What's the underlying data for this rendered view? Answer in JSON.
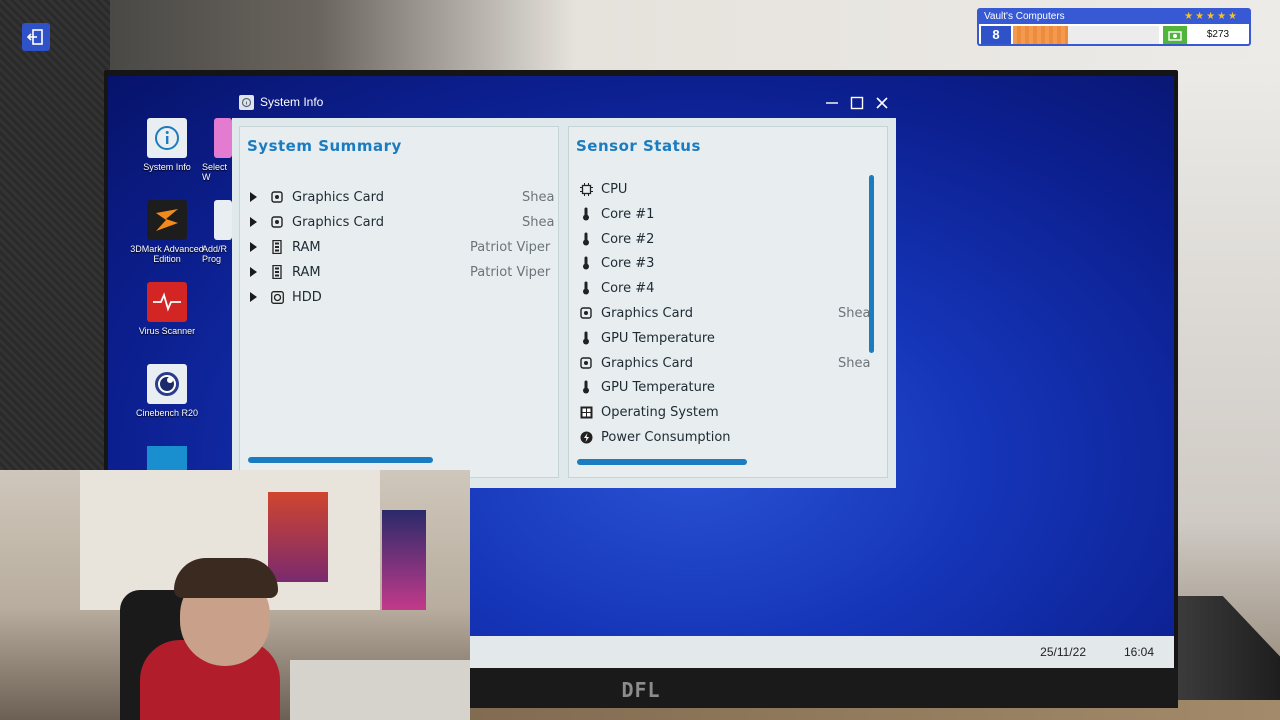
{
  "hud": {
    "company": "Vault's Computers",
    "stars": "★★★★★",
    "level": "8",
    "xp_fraction": 0.38,
    "cash": "$273",
    "colors": {
      "accent": "#3759d3",
      "xp": "#f39a50",
      "cash": "#52b43d"
    }
  },
  "desktop_icons": [
    {
      "label": "System Info",
      "icon": "info-icon"
    },
    {
      "label": "Select W",
      "icon": "app-icon"
    },
    {
      "label": "3DMark Advanced Edition",
      "icon": "3dmark-icon"
    },
    {
      "label": "Add/R Prog",
      "icon": "add-remove-icon"
    },
    {
      "label": "Virus Scanner",
      "icon": "pulse-icon"
    },
    {
      "label": "Cinebench R20",
      "icon": "cinema4d-icon"
    }
  ],
  "window": {
    "title": "System Info",
    "summary": {
      "title": "System Summary",
      "items": [
        {
          "name": "Graphics Card",
          "value": "Shea",
          "icon": "gpu-icon"
        },
        {
          "name": "Graphics Card",
          "value": "Shea",
          "icon": "gpu-icon"
        },
        {
          "name": "RAM",
          "value": "Patriot Viper",
          "icon": "ram-icon"
        },
        {
          "name": "RAM",
          "value": "Patriot Viper",
          "icon": "ram-icon"
        },
        {
          "name": "HDD",
          "value": "",
          "icon": "hdd-icon"
        }
      ]
    },
    "sensors": {
      "title": "Sensor Status",
      "items": [
        {
          "name": "CPU",
          "value": "",
          "icon": "chip-icon"
        },
        {
          "name": "Core #1",
          "value": "",
          "icon": "thermometer-icon"
        },
        {
          "name": "Core #2",
          "value": "",
          "icon": "thermometer-icon"
        },
        {
          "name": "Core #3",
          "value": "",
          "icon": "thermometer-icon"
        },
        {
          "name": "Core #4",
          "value": "",
          "icon": "thermometer-icon"
        },
        {
          "name": "Graphics Card",
          "value": "Shea",
          "icon": "gpu-icon"
        },
        {
          "name": "GPU Temperature",
          "value": "",
          "icon": "thermometer-icon"
        },
        {
          "name": "Graphics Card",
          "value": "Shea",
          "icon": "gpu-icon"
        },
        {
          "name": "GPU Temperature",
          "value": "",
          "icon": "thermometer-icon"
        },
        {
          "name": "Operating System",
          "value": "",
          "icon": "os-icon"
        },
        {
          "name": "Power Consumption",
          "value": "",
          "icon": "bolt-icon"
        }
      ]
    }
  },
  "taskbar": {
    "date": "25/11/22",
    "time": "16:04"
  },
  "monitor": {
    "brand": "DFL"
  }
}
